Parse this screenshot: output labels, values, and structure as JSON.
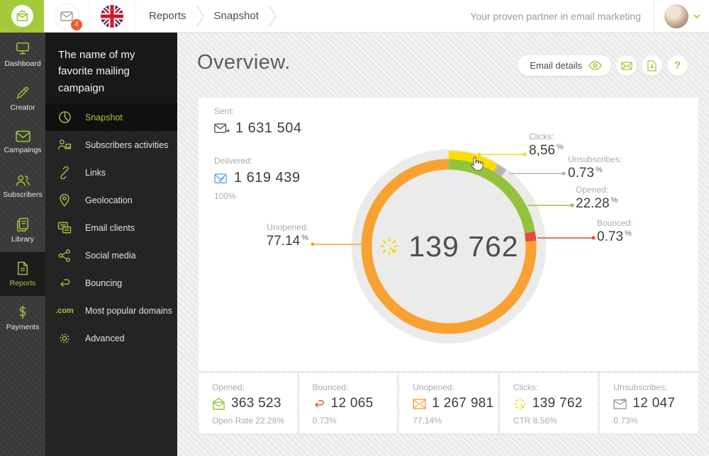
{
  "colors": {
    "accent": "#a5c93c",
    "badge": "#f15a29",
    "delivered_blue": "#64b0e8"
  },
  "topbar": {
    "notifications_badge": "4",
    "breadcrumbs": [
      "Reports",
      "Snapshot"
    ],
    "tagline": "Your proven partner in email marketing"
  },
  "sidebar": {
    "items": [
      {
        "label": "Dashboard"
      },
      {
        "label": "Creator"
      },
      {
        "label": "Campaings"
      },
      {
        "label": "Subscribers"
      },
      {
        "label": "Library"
      },
      {
        "label": "Reports",
        "active": true
      },
      {
        "label": "Payments"
      }
    ]
  },
  "panel": {
    "campaign_name": "The name of my favorite mailing campaign",
    "items": [
      {
        "label": "Snapshot",
        "active": true
      },
      {
        "label": "Subscribers activities"
      },
      {
        "label": "Links"
      },
      {
        "label": "Geolocation"
      },
      {
        "label": "Email clients"
      },
      {
        "label": "Social media"
      },
      {
        "label": "Bouncing"
      },
      {
        "label": "Most popular domains",
        "icon_text": ".com"
      },
      {
        "label": "Advanced"
      }
    ]
  },
  "main": {
    "title": "Overview.",
    "email_details": "Email details",
    "help": "?"
  },
  "totals": {
    "sent": {
      "label": "Sent:",
      "value": "1 631 504"
    },
    "delivered": {
      "label": "Delivered:",
      "value": "1 619 439",
      "sub": "100%"
    }
  },
  "chart_data": {
    "type": "donut",
    "center_value": "139 762",
    "ring": [
      {
        "name": "opened",
        "label": "Opened:",
        "pct": 22.28,
        "display": "22.28",
        "unit": "%",
        "color": "#95c23c",
        "count": 363523
      },
      {
        "name": "bounced",
        "label": "Bounced:",
        "pct": 0.73,
        "display": "0.73",
        "unit": "%",
        "color": "#e9493d",
        "count": 12065
      },
      {
        "name": "unopened",
        "label": "Unopened:",
        "pct": 77.14,
        "display": "77.14",
        "unit": "%",
        "color": "#f7a233",
        "count": 1267981
      }
    ],
    "overlay": [
      {
        "name": "clicks",
        "label": "Clicks:",
        "pct": 8.56,
        "display": "8,56",
        "unit": "%",
        "color": "#f8dd00",
        "count": 139762
      },
      {
        "name": "unsubscribes",
        "label": "Unsubscribes:",
        "pct": 0.73,
        "display": "0.73",
        "unit": "%",
        "color": "#b5b5b5",
        "count": 12047
      }
    ]
  },
  "cards": [
    {
      "label": "Opened:",
      "value": "363 523",
      "sub": "Open Rate 22.28%"
    },
    {
      "label": "Bounced:",
      "value": "12 065",
      "sub": "0.73%"
    },
    {
      "label": "Unopened:",
      "value": "1 267 981",
      "sub": "77.14%"
    },
    {
      "label": "Clicks:",
      "value": "139 762",
      "sub": "CTR 8.56%"
    },
    {
      "label": "Unsubscribes:",
      "value": "12 047",
      "sub": "0.73%"
    }
  ]
}
